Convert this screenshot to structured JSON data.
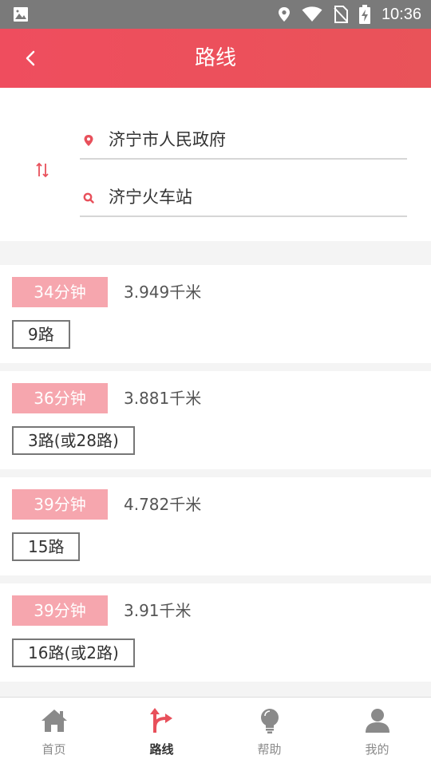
{
  "status_bar": {
    "time": "10:36"
  },
  "header": {
    "title": "路线"
  },
  "search": {
    "origin": "济宁市人民政府",
    "destination": "济宁火车站"
  },
  "routes": [
    {
      "duration": "34分钟",
      "distance": "3.949千米",
      "line": "9路"
    },
    {
      "duration": "36分钟",
      "distance": "3.881千米",
      "line": "3路(或28路)"
    },
    {
      "duration": "39分钟",
      "distance": "4.782千米",
      "line": "15路"
    },
    {
      "duration": "39分钟",
      "distance": "3.91千米",
      "line": "16路(或2路)"
    }
  ],
  "tabbar": {
    "active": "路线",
    "items": [
      {
        "label": "首页",
        "icon": "home-icon"
      },
      {
        "label": "路线",
        "icon": "route-icon"
      },
      {
        "label": "帮助",
        "icon": "lightbulb-icon"
      },
      {
        "label": "我的",
        "icon": "user-icon"
      }
    ]
  },
  "colors": {
    "accent": "#ef4d5e",
    "duration_bg": "#f6a6ae",
    "status_bar": "#7a7a7a"
  }
}
